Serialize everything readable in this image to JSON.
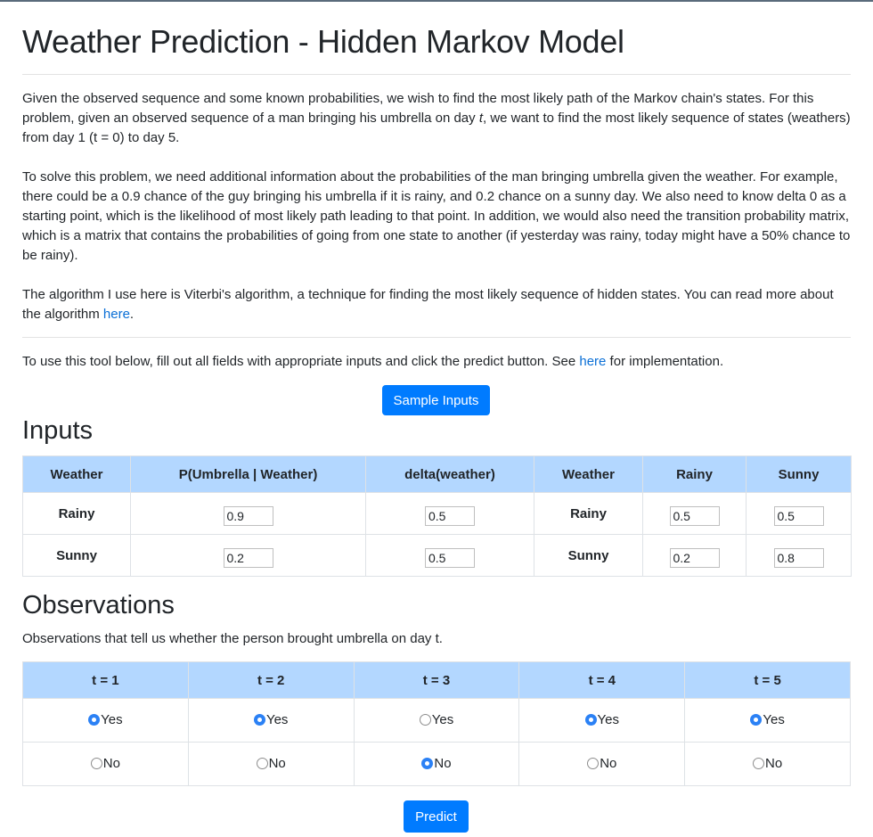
{
  "title": "Weather Prediction - Hidden Markov Model",
  "intro": {
    "p1_a": "Given the observed sequence and some known probabilities, we wish to find the most likely path of the Markov chain's states. For this problem, given an observed sequence of a man bringing his umbrella on day ",
    "p1_t": "t",
    "p1_b": ", we want to find the most likely sequence of states (weathers) from day 1 (t = 0) to day 5.",
    "p2": "To solve this problem, we need additional information about the probabilities of the man bringing umbrella given the weather. For example, there could be a 0.9 chance of the guy bringing his umbrella if it is rainy, and 0.2 chance on a sunny day. We also need to know delta 0 as a starting point, which is the likelihood of most likely path leading to that point. In addition, we would also need the transition probability matrix, which is a matrix that contains the probabilities of going from one state to another (if yesterday was rainy, today might have a 50% chance to be rainy).",
    "p3_a": "The algorithm I use here is Viterbi's algorithm, a technique for finding the most likely sequence of hidden states. You can read more about the algorithm ",
    "p3_link": "here",
    "p3_b": "."
  },
  "usage": {
    "text_a": "To use this tool below, fill out all fields with appropriate inputs and click the predict button. See ",
    "link": "here",
    "text_b": " for implementation."
  },
  "sample_button": "Sample Inputs",
  "inputs": {
    "heading": "Inputs",
    "headers": [
      "Weather",
      "P(Umbrella | Weather)",
      "delta(weather)",
      "Weather",
      "Rainy",
      "Sunny"
    ],
    "rows": [
      {
        "label": "Rainy",
        "p_umbrella": "0.9",
        "delta": "0.5",
        "label2": "Rainy",
        "to_rainy": "0.5",
        "to_sunny": "0.5"
      },
      {
        "label": "Sunny",
        "p_umbrella": "0.2",
        "delta": "0.5",
        "label2": "Sunny",
        "to_rainy": "0.2",
        "to_sunny": "0.8"
      }
    ]
  },
  "observations": {
    "heading": "Observations",
    "description": "Observations that tell us whether the person brought umbrella on day t.",
    "headers": [
      "t = 1",
      "t = 2",
      "t = 3",
      "t = 4",
      "t = 5"
    ],
    "yes_label": "Yes",
    "no_label": "No",
    "selected": [
      "Yes",
      "Yes",
      "No",
      "Yes",
      "Yes"
    ]
  },
  "predict_button": "Predict",
  "colors": {
    "primary": "#007bff",
    "table_header": "#b3d7ff",
    "link": "#0a6fd6",
    "radio_selected": "#2b81f5"
  }
}
